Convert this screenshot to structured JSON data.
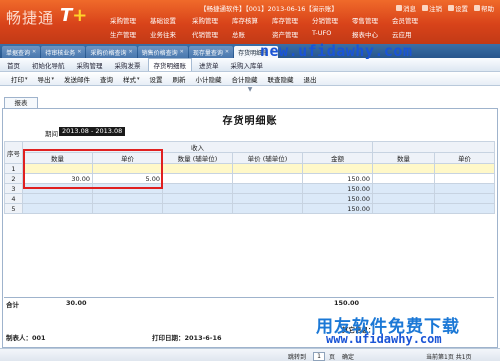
{
  "app": {
    "logo_cn": "畅捷通",
    "logo_t": "T",
    "logo_plus": "+",
    "info_line": "【畅捷通软件】【001】2013-06-16【演示账】",
    "top_tools": [
      "消息",
      "注销",
      "设置",
      "帮助"
    ],
    "modules_row1": [
      "采购管理",
      "基础设置",
      "采购管理",
      "库存核算",
      "库存管理",
      "分销管理",
      "零售管理",
      "会员管理"
    ],
    "modules_row2": [
      "生产管理",
      "业务往来",
      "代销管理",
      "总账",
      "资产管理",
      "T-UFO",
      "报表中心",
      "云应用"
    ]
  },
  "tabs": [
    {
      "label": "单据查询"
    },
    {
      "label": "待审核业务"
    },
    {
      "label": "采购价格查询"
    },
    {
      "label": "销售价格查询"
    },
    {
      "label": "现存量查询"
    },
    {
      "label": "存货明细账"
    }
  ],
  "nav": [
    {
      "label": "首页"
    },
    {
      "label": "初始化导航"
    },
    {
      "label": "采购管理"
    },
    {
      "label": "采购发票"
    },
    {
      "label": "存货明细账"
    },
    {
      "label": "进货单"
    },
    {
      "label": "采购入库单"
    }
  ],
  "toolbar": [
    {
      "label": "打印",
      "dropdown": true
    },
    {
      "label": "导出",
      "dropdown": true
    },
    {
      "label": "发送邮件",
      "dropdown": false
    },
    {
      "label": "查询",
      "dropdown": false
    },
    {
      "label": "样式",
      "dropdown": true
    },
    {
      "label": "设置",
      "dropdown": false
    },
    {
      "label": "刷新",
      "dropdown": false
    },
    {
      "label": "小计隐藏",
      "dropdown": false
    },
    {
      "label": "合计隐藏",
      "dropdown": false
    },
    {
      "label": "联查隐藏",
      "dropdown": false
    },
    {
      "label": "退出",
      "dropdown": false
    }
  ],
  "report": {
    "tab_label": "报表",
    "title": "存货明细账",
    "period_label": "期间",
    "period_value": "2013.08 - 2013.08",
    "group_header": "收入",
    "columns": [
      "序号",
      "数量",
      "单价",
      "数量 (辅单位)",
      "单价 (辅单位)",
      "金额",
      "数量",
      "单价"
    ],
    "rows": [
      {
        "idx": "1",
        "qty": "",
        "price": "",
        "qty_aux": "",
        "price_aux": "",
        "amount": "",
        "qty2": "",
        "price2": ""
      },
      {
        "idx": "2",
        "qty": "30.00",
        "price": "5.00",
        "qty_aux": "",
        "price_aux": "",
        "amount": "150.00",
        "qty2": "",
        "price2": ""
      },
      {
        "idx": "3",
        "qty": "",
        "price": "",
        "qty_aux": "",
        "price_aux": "",
        "amount": "150.00",
        "qty2": "",
        "price2": ""
      },
      {
        "idx": "4",
        "qty": "",
        "price": "",
        "qty_aux": "",
        "price_aux": "",
        "amount": "150.00",
        "qty2": "",
        "price2": ""
      },
      {
        "idx": "5",
        "qty": "",
        "price": "",
        "qty_aux": "",
        "price_aux": "",
        "amount": "150.00",
        "qty2": "",
        "price2": ""
      }
    ],
    "total_label": "合计",
    "total_qty": "30.00",
    "total_amount": "150.00"
  },
  "footer": {
    "maker": "制表人：001",
    "print_date": "打印日期：2013-6-16",
    "other_info": "其它信息："
  },
  "status": {
    "goto_label": "跳转到",
    "page": "1",
    "page_unit": "页",
    "confirm": "确定",
    "page_info": "当前第1页 共1页"
  },
  "watermarks": {
    "url_top": "new.ufidawhy.com",
    "cn_bottom": "用友软件免费下载",
    "url_bottom": "www.ufidawhy.com"
  },
  "colors": {
    "banner": "#d8431a",
    "highlight": "#e02020",
    "watermark": "#1a54d6"
  }
}
